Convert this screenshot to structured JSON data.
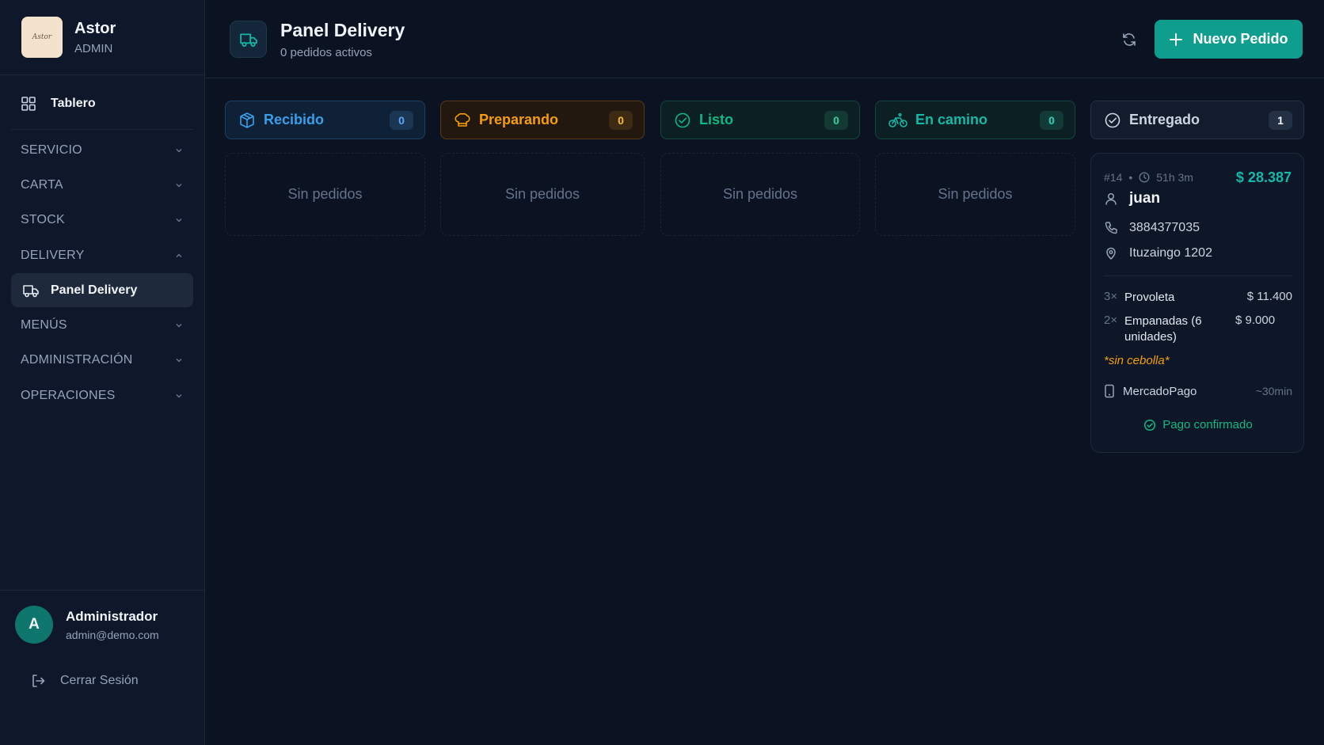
{
  "brand": {
    "logo_text": "Astor",
    "name": "Astor",
    "role": "ADMIN"
  },
  "sidebar": {
    "dashboard": "Tablero",
    "sections": [
      {
        "label": "SERVICIO",
        "expanded": false
      },
      {
        "label": "CARTA",
        "expanded": false
      },
      {
        "label": "STOCK",
        "expanded": false
      },
      {
        "label": "DELIVERY",
        "expanded": true
      },
      {
        "label": "MENÚS",
        "expanded": false
      },
      {
        "label": "ADMINISTRACIÓN",
        "expanded": false
      },
      {
        "label": "OPERACIONES",
        "expanded": false
      }
    ],
    "active_item": "Panel Delivery"
  },
  "user": {
    "initial": "A",
    "name": "Administrador",
    "email": "admin@demo.com",
    "logout": "Cerrar Sesión"
  },
  "header": {
    "title": "Panel Delivery",
    "subtitle": "0 pedidos activos",
    "new_order": "Nuevo Pedido"
  },
  "columns": [
    {
      "label": "Recibido",
      "count": "0",
      "icon": "box-icon",
      "color": "#3b9ee8"
    },
    {
      "label": "Preparando",
      "count": "0",
      "icon": "chef-hat-icon",
      "color": "#f59e0b"
    },
    {
      "label": "Listo",
      "count": "0",
      "icon": "check-circle-icon",
      "color": "#10b981"
    },
    {
      "label": "En camino",
      "count": "0",
      "icon": "bike-icon",
      "color": "#14b8a6"
    },
    {
      "label": "Entregado",
      "count": "1",
      "icon": "check-circle-icon",
      "color": "#94a3b8"
    }
  ],
  "empty_text": "Sin pedidos",
  "order": {
    "number": "#14",
    "elapsed": "51h 3m",
    "total": "$ 28.387",
    "customer": "juan",
    "phone": "3884377035",
    "address": "Ituzaingo 1202",
    "items": [
      {
        "qty": "3×",
        "name": "Provoleta",
        "price": "$ 11.400"
      },
      {
        "qty": "2×",
        "name": "Empanadas (6 unidades)",
        "price": "$ 9.000"
      }
    ],
    "note": "*sin cebolla*",
    "payment": "MercadoPago",
    "eta": "~30min",
    "status": "Pago confirmado"
  }
}
